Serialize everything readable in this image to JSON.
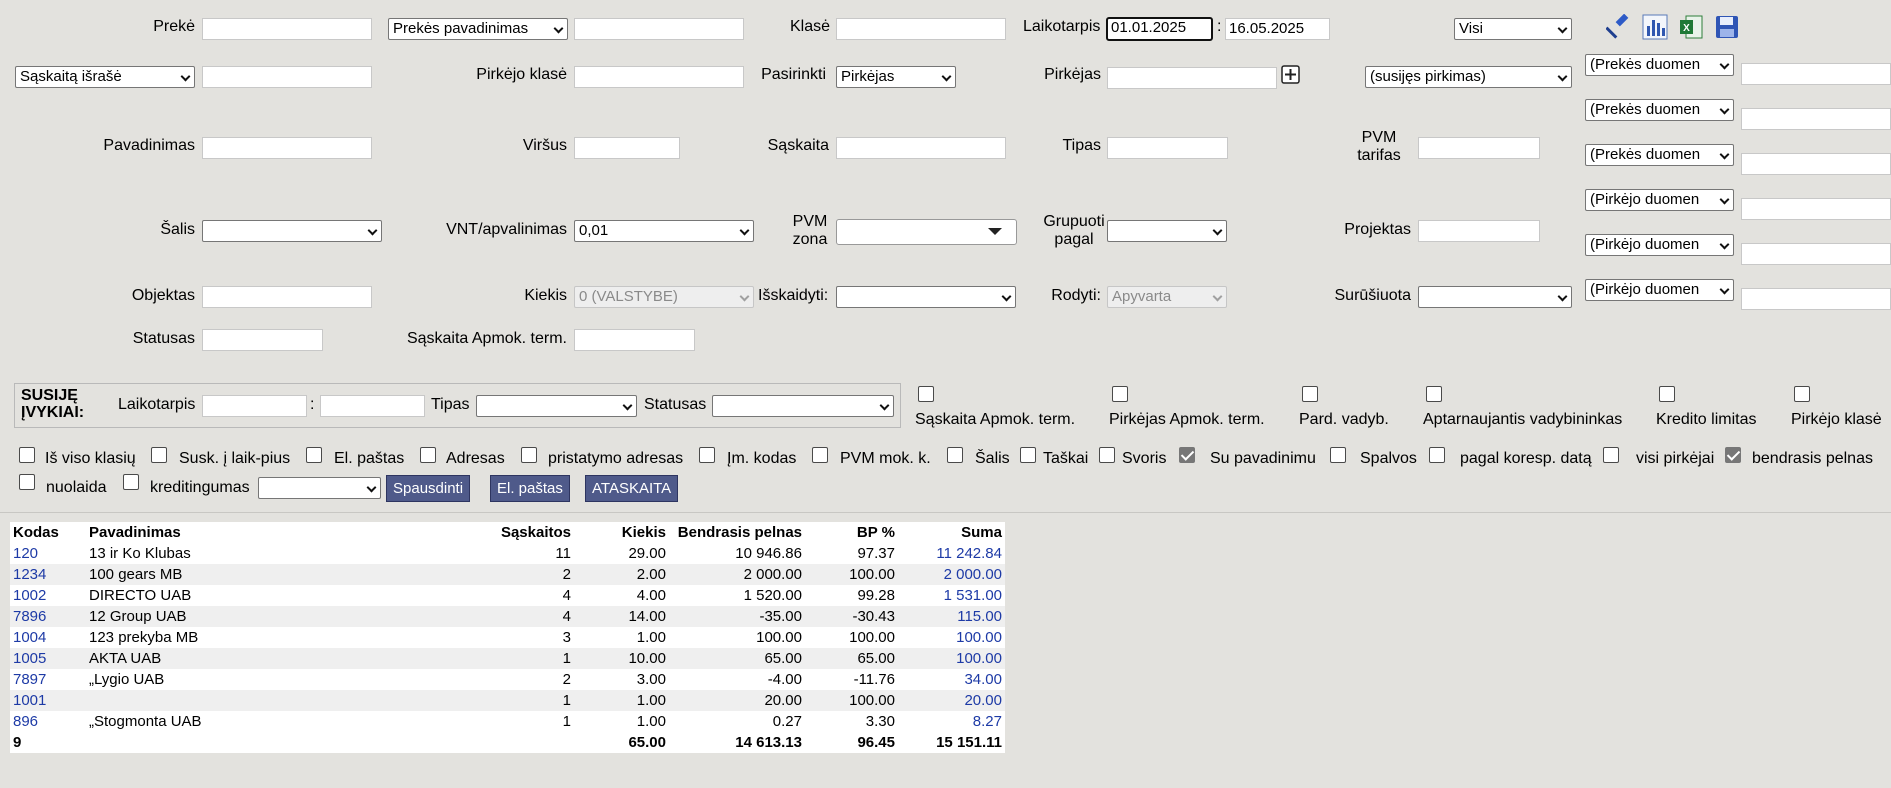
{
  "filters": {
    "preke_label": "Prekė",
    "preke_type_select": "Prekės pavadinimas",
    "klase_label": "Klasė",
    "laikotarpis_label": "Laikotarpis",
    "date_from": "01.01.2025",
    "date_sep": ":",
    "date_to": "16.05.2025",
    "visi_select": "Visi",
    "saskaita_israse_select": "Sąskaitą išrašė",
    "pirkejo_klase_label": "Pirkėjo klasė",
    "pasirinkti_label": "Pasirinkti",
    "pasirinkti_select": "Pirkėjas",
    "pirkejas_label": "Pirkėjas",
    "susijes_pirkimas_select": "(susijęs pirkimas)",
    "pavadinimas_label": "Pavadinimas",
    "virsus_label": "Viršus",
    "saskaita_label": "Sąskaita",
    "tipas_label": "Tipas",
    "pvm_tarifas_label_1": "PVM",
    "pvm_tarifas_label_2": "tarifas",
    "salis_label": "Šalis",
    "vnt_label": "VNT/apvalinimas",
    "vnt_select": "0,01",
    "pvm_zona_label_1": "PVM",
    "pvm_zona_label_2": "zona",
    "grupuoti_label_1": "Grupuoti",
    "grupuoti_label_2": "pagal",
    "projektas_label": "Projektas",
    "objektas_label": "Objektas",
    "kiekis_label": "Kiekis",
    "kiekis_select": "0 (VALSTYBE)",
    "isskaidyti_label": "Išskaidyti:",
    "rodyti_label": "Rodyti:",
    "rodyti_select": "Apyvarta",
    "surusiuota_label": "Surūšiuota",
    "statusas_label": "Statusas",
    "apmok_term_label": "Sąskaita Apmok. term."
  },
  "extra_selects": [
    "(Prekės duomen",
    "(Prekės duomen",
    "(Prekės duomen",
    "(Pirkėjo duomen",
    "(Pirkėjo duomen",
    "(Pirkėjo duomen"
  ],
  "related": {
    "title_1": "SUSIJĘ",
    "title_2": "ĮVYKIAI:",
    "laikotarpis_label": "Laikotarpis",
    "sep": ":",
    "tipas_label": "Tipas",
    "statusas_label": "Statusas"
  },
  "top_checks": [
    {
      "label": "Sąskaita Apmok. term.",
      "checked": false
    },
    {
      "label": "Pirkėjas Apmok. term.",
      "checked": false
    },
    {
      "label": "Pard. vadyb.",
      "checked": false
    },
    {
      "label": "Aptarnaujantis vadybininkas",
      "checked": false
    },
    {
      "label": "Kredito limitas",
      "checked": false
    },
    {
      "label": "Pirkėjo klasė",
      "checked": false
    }
  ],
  "options": [
    {
      "label": "Iš viso klasių",
      "checked": false
    },
    {
      "label": "Susk. į laik-pius",
      "checked": false
    },
    {
      "label": "El. paštas",
      "checked": false
    },
    {
      "label": "Adresas",
      "checked": false
    },
    {
      "label": "pristatymo adresas",
      "checked": false
    },
    {
      "label": "Įm. kodas",
      "checked": false
    },
    {
      "label": "PVM mok. k.",
      "checked": false
    },
    {
      "label": "Šalis",
      "checked": false
    },
    {
      "label": "Taškai",
      "checked": false
    },
    {
      "label": "Svoris",
      "checked": false
    },
    {
      "label": "Su pavadinimu",
      "checked": true
    },
    {
      "label": "Spalvos",
      "checked": false
    },
    {
      "label": "pagal koresp. datą",
      "checked": false
    },
    {
      "label": "visi pirkėjai",
      "checked": false
    },
    {
      "label": "bendrasis pelnas",
      "checked": true
    },
    {
      "label": "nuolaida",
      "checked": false
    },
    {
      "label": "kreditingumas",
      "checked": false
    }
  ],
  "buttons": {
    "print": "Spausdinti",
    "email": "El. paštas",
    "report": "ATASKAITA"
  },
  "icons": [
    "hammer-icon",
    "chart-icon",
    "excel-icon",
    "save-icon"
  ],
  "table": {
    "headers": [
      "Kodas",
      "Pavadinimas",
      "Sąskaitos",
      "Kiekis",
      "Bendrasis pelnas",
      "BP %",
      "Suma"
    ],
    "rows": [
      [
        "120",
        "13 ir Ko Klubas",
        "11",
        "29.00",
        "10 946.86",
        "97.37",
        "11 242.84"
      ],
      [
        "1234",
        "100 gears MB",
        "2",
        "2.00",
        "2 000.00",
        "100.00",
        "2 000.00"
      ],
      [
        "1002",
        "DIRECTO UAB",
        "4",
        "4.00",
        "1 520.00",
        "99.28",
        "1 531.00"
      ],
      [
        "7896",
        "12 Group UAB",
        "4",
        "14.00",
        "-35.00",
        "-30.43",
        "115.00"
      ],
      [
        "1004",
        "123 prekyba MB",
        "3",
        "1.00",
        "100.00",
        "100.00",
        "100.00"
      ],
      [
        "1005",
        "AKTA UAB",
        "1",
        "10.00",
        "65.00",
        "65.00",
        "100.00"
      ],
      [
        "7897",
        "„Lygio UAB",
        "2",
        "3.00",
        "-4.00",
        "-11.76",
        "34.00"
      ],
      [
        "1001",
        "",
        "1",
        "1.00",
        "20.00",
        "100.00",
        "20.00"
      ],
      [
        "896",
        "„Stogmonta UAB",
        "1",
        "1.00",
        "0.27",
        "3.30",
        "8.27"
      ]
    ],
    "totals": [
      "9",
      "",
      "",
      "65.00",
      "14 613.13",
      "96.45",
      "15 151.11"
    ]
  }
}
